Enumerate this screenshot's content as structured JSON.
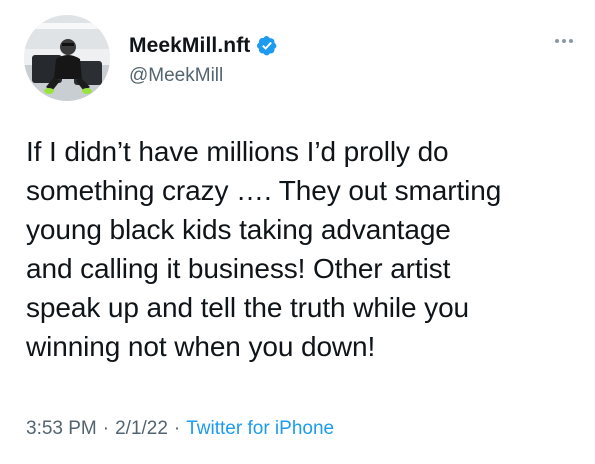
{
  "author": {
    "display_name": "MeekMill.nft",
    "handle": "@MeekMill",
    "verified": true,
    "verified_color": "#1d9bf0"
  },
  "tweet": {
    "text": "If I didn’t have millions I’d prolly do\nsomething crazy …. They out smarting\nyoung black kids taking advantage\nand calling it business! Other artist\nspeak up and tell the truth while you\nwinning not when you down!"
  },
  "meta": {
    "time": "3:53 PM",
    "separator": "·",
    "date": "2/1/22",
    "source": "Twitter for iPhone"
  },
  "icons": {
    "more": "more-horizontal-icon",
    "verified": "verified-badge-icon"
  },
  "colors": {
    "text": "#0f1419",
    "secondary": "#536471",
    "link": "#1d9bf0"
  }
}
